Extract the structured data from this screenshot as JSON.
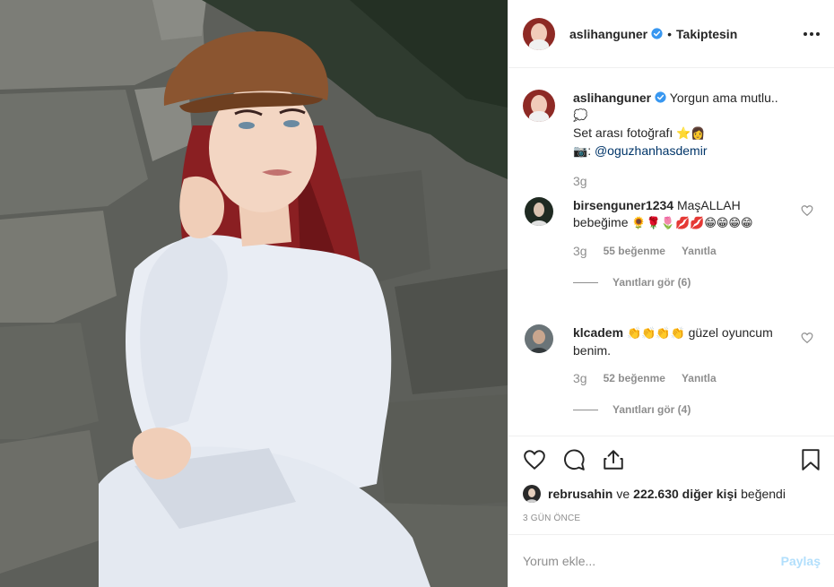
{
  "post": {
    "author": "aslihanguner",
    "follow_dot": "•",
    "follow_status": "Takiptesin"
  },
  "caption": {
    "username": "aslihanguner",
    "line1": "Yorgun ama mutlu..",
    "line2_emoji": "💭",
    "line3": "Set arası fotoğrafı",
    "line3_emoji": "⭐👩",
    "line4_emoji": "📷",
    "line4_sep": ":",
    "mention": "@oguzhanhasdemir",
    "time": "3g"
  },
  "comments": [
    {
      "username": "birsenguner1234",
      "text": "MaşALLAH bebeğime",
      "emoji": "🌻🌹🌷💋💋😁😁😁😁",
      "time": "3g",
      "likes": "55 beğenme",
      "reply_label": "Yanıtla",
      "replies_label": "Yanıtları gör (6)"
    },
    {
      "username": "klcadem",
      "emoji": "👏👏👏👏",
      "text": "güzel oyuncum benim.",
      "time": "3g",
      "likes": "52 beğenme",
      "reply_label": "Yanıtla",
      "replies_label": "Yanıtları gör (4)"
    }
  ],
  "likes_summary": {
    "first_user": "rebrusahin",
    "connector": "ve",
    "others": "222.630 diğer kişi",
    "suffix": "beğendi"
  },
  "date": "3 GÜN ÖNCE",
  "add_comment": {
    "placeholder": "Yorum ekle...",
    "post_label": "Paylaş"
  },
  "icons": {
    "more": "more-dots-icon",
    "verified": "verified-badge-icon",
    "like": "heart-icon",
    "comment": "comment-bubble-icon",
    "share": "share-icon",
    "save": "bookmark-icon"
  },
  "colors": {
    "verified": "#3897f0",
    "mention": "#003569",
    "muted": "#8e8e8e",
    "post_disabled": "#b2dffc"
  }
}
